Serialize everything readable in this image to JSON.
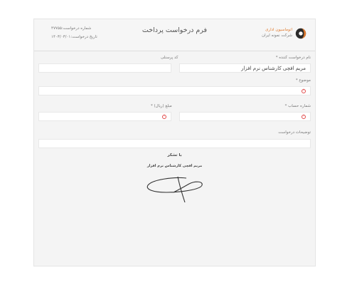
{
  "header": {
    "title": "فرم درخواست پرداخت",
    "request_number": "شماره درخواست:۴۷۷۵۵",
    "request_date": "تاریخ درخواست:۱۴۰۳/۰۳/۰۱",
    "company_line1": "اتوماسیون اداری",
    "company_line2": "شرکت نمونه ایران"
  },
  "form": {
    "requester_label": "نام درخواست کننده *",
    "requester_value": "مریم افچی کارشناس نرم افزار",
    "personnel_code_label": "کد پرسنلی",
    "personnel_code_value": "",
    "subject_label": "موضوع *",
    "account_label": "شماره حساب *",
    "amount_label": "مبلغ (ریال) *",
    "description_label": "توضیحات درخواست",
    "error_glyph": "!"
  },
  "signature": {
    "thanks": "با تشکر",
    "signer": "مریم افچی کارشناس نرم افزار"
  },
  "colors": {
    "error": "#e24a4a",
    "brand_orange": "#e07a2e"
  }
}
